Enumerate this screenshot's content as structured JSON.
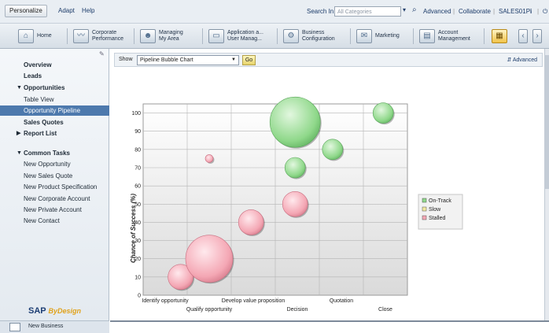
{
  "topbar": {
    "personalize": "Personalize",
    "adapt": "Adapt",
    "help": "Help",
    "search_label": "Search In:",
    "search_placeholder": "All Categories",
    "advanced": "Advanced",
    "collaborate": "Collaborate",
    "user": "SALES01P"
  },
  "nav": [
    {
      "label": "Home",
      "icon": "home-icon"
    },
    {
      "label": "Corporate Performance",
      "icon": "chart-icon"
    },
    {
      "label": "Managing My Area",
      "icon": "people-icon"
    },
    {
      "label": "Application a... User Manag...",
      "icon": "folder-icon"
    },
    {
      "label": "Business Configuration",
      "icon": "gears-icon"
    },
    {
      "label": "Marketing",
      "icon": "marketing-icon"
    },
    {
      "label": "Account Management",
      "icon": "account-icon"
    }
  ],
  "sidebar": {
    "overview": "Overview",
    "leads": "Leads",
    "opportunities": "Opportunities",
    "table_view": "Table View",
    "opportunity_pipeline": "Opportunity Pipeline",
    "sales_quotes": "Sales Quotes",
    "report_list": "Report List",
    "common_tasks": "Common Tasks",
    "tasks": [
      "New Opportunity",
      "New Sales Quote",
      "New Product Specification",
      "New Corporate Account",
      "New Private Account",
      "New Contact"
    ],
    "logo_main": "SAP",
    "logo_sub": "ByDesign",
    "bottom_item": "New Business"
  },
  "toolbar": {
    "show_label": "Show",
    "selected": "Pipeline Bubble Chart",
    "go": "Go",
    "advanced": "Advanced"
  },
  "chart_data": {
    "type": "scatter",
    "ylabel": "Chance of Success (%)",
    "ylim": [
      0,
      105
    ],
    "yticks": [
      0,
      10,
      20,
      30,
      40,
      50,
      60,
      70,
      80,
      90,
      100
    ],
    "categories_row1": [
      "Identify opportunity",
      "Develop value proposition",
      "Quotation"
    ],
    "categories_row2": [
      "Qualify opportunity",
      "Decision",
      "Close"
    ],
    "categories": [
      "Identify opportunity",
      "Qualify opportunity",
      "Develop value proposition",
      "Decision",
      "Quotation",
      "Close"
    ],
    "legend": [
      {
        "name": "On-Track",
        "color": "#8fd88a"
      },
      {
        "name": "Slow",
        "color": "#f2e9a0"
      },
      {
        "name": "Stalled",
        "color": "#f4a7b4"
      }
    ],
    "points": [
      {
        "x": 0.35,
        "y": 10,
        "size": 16,
        "status": "Stalled"
      },
      {
        "x": 1.0,
        "y": 75,
        "size": 5,
        "status": "Stalled"
      },
      {
        "x": 1.0,
        "y": 20,
        "size": 30,
        "status": "Stalled"
      },
      {
        "x": 1.95,
        "y": 40,
        "size": 16,
        "status": "Stalled"
      },
      {
        "x": 2.95,
        "y": 50,
        "size": 16,
        "status": "Stalled"
      },
      {
        "x": 2.95,
        "y": 70,
        "size": 13,
        "status": "On-Track"
      },
      {
        "x": 2.95,
        "y": 95,
        "size": 32,
        "status": "On-Track"
      },
      {
        "x": 3.8,
        "y": 80,
        "size": 13,
        "status": "On-Track"
      },
      {
        "x": 4.95,
        "y": 100,
        "size": 13,
        "status": "On-Track"
      }
    ]
  }
}
